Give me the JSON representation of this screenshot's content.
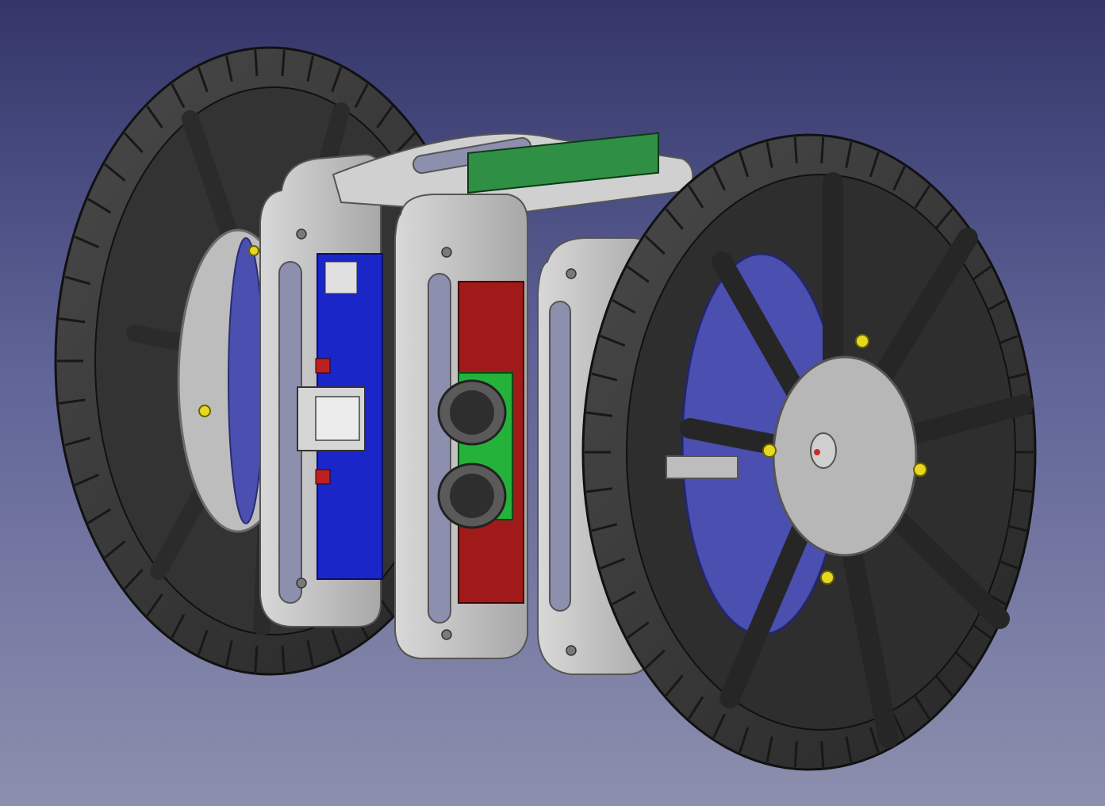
{
  "viewport": {
    "background_top": "#34366a",
    "background_bottom": "#8d8fae"
  },
  "model": {
    "colors": {
      "tire": "#3a3a3a",
      "tire_dark": "#232323",
      "frame": "#c9c9c9",
      "frame_shadow": "#8c8c8c",
      "pcb_blue": "#1b26c8",
      "pcb_red": "#a11a1a",
      "pcb_green": "#25b23a",
      "motor_blue": "#4a4fb0",
      "hub": "#b7b7b7",
      "bolt_yellow": "#e6d820"
    }
  }
}
